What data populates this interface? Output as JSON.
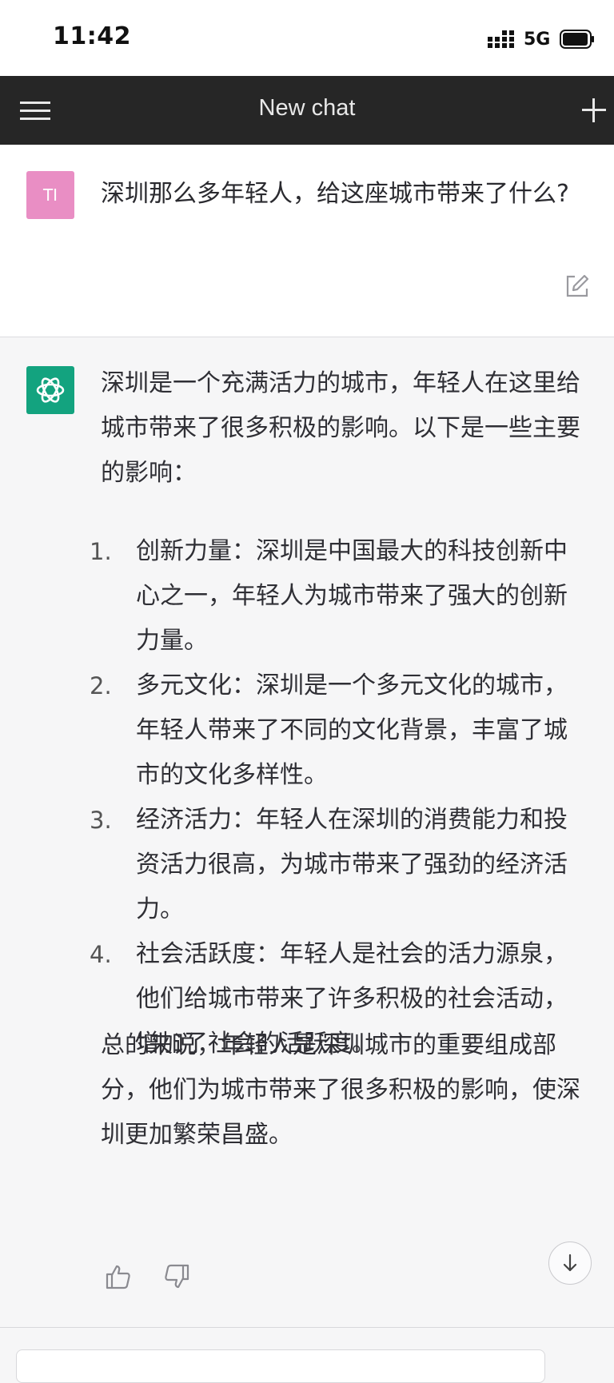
{
  "status_bar": {
    "time": "11:42",
    "network": "5G"
  },
  "header": {
    "title": "New chat"
  },
  "user_message": {
    "avatar_initials": "TI",
    "text": "深圳那么多年轻人，给这座城市带来了什么?"
  },
  "assistant_message": {
    "intro": "深圳是一个充满活力的城市，年轻人在这里给城市带来了很多积极的影响。以下是一些主要的影响：",
    "items": [
      {
        "number": "1.",
        "text": "创新力量：深圳是中国最大的科技创新中心之一，年轻人为城市带来了强大的创新力量。"
      },
      {
        "number": "2.",
        "text": "多元文化：深圳是一个多元文化的城市，年轻人带来了不同的文化背景，丰富了城市的文化多样性。"
      },
      {
        "number": "3.",
        "text": "经济活力：年轻人在深圳的消费能力和投资活力很高，为城市带来了强劲的经济活力。"
      },
      {
        "number": "4.",
        "text": "社会活跃度：年轻人是社会的活力源泉，他们给城市带来了许多积极的社会活动，增加了社会的活跃度。"
      }
    ],
    "summary": "总的来说，年轻人是深圳城市的重要组成部分，他们为城市带来了很多积极的影响，使深圳更加繁荣昌盛。"
  },
  "colors": {
    "navbar": "#262626",
    "user_avatar": "#e98ec4",
    "assistant_avatar": "#13a37f",
    "assistant_bg": "#f6f6f7"
  },
  "icons": [
    "menu-icon",
    "plus-icon",
    "edit-icon",
    "openai-logo-icon",
    "thumbs-up-icon",
    "thumbs-down-icon",
    "arrow-down-icon",
    "signal-icon",
    "battery-icon"
  ]
}
